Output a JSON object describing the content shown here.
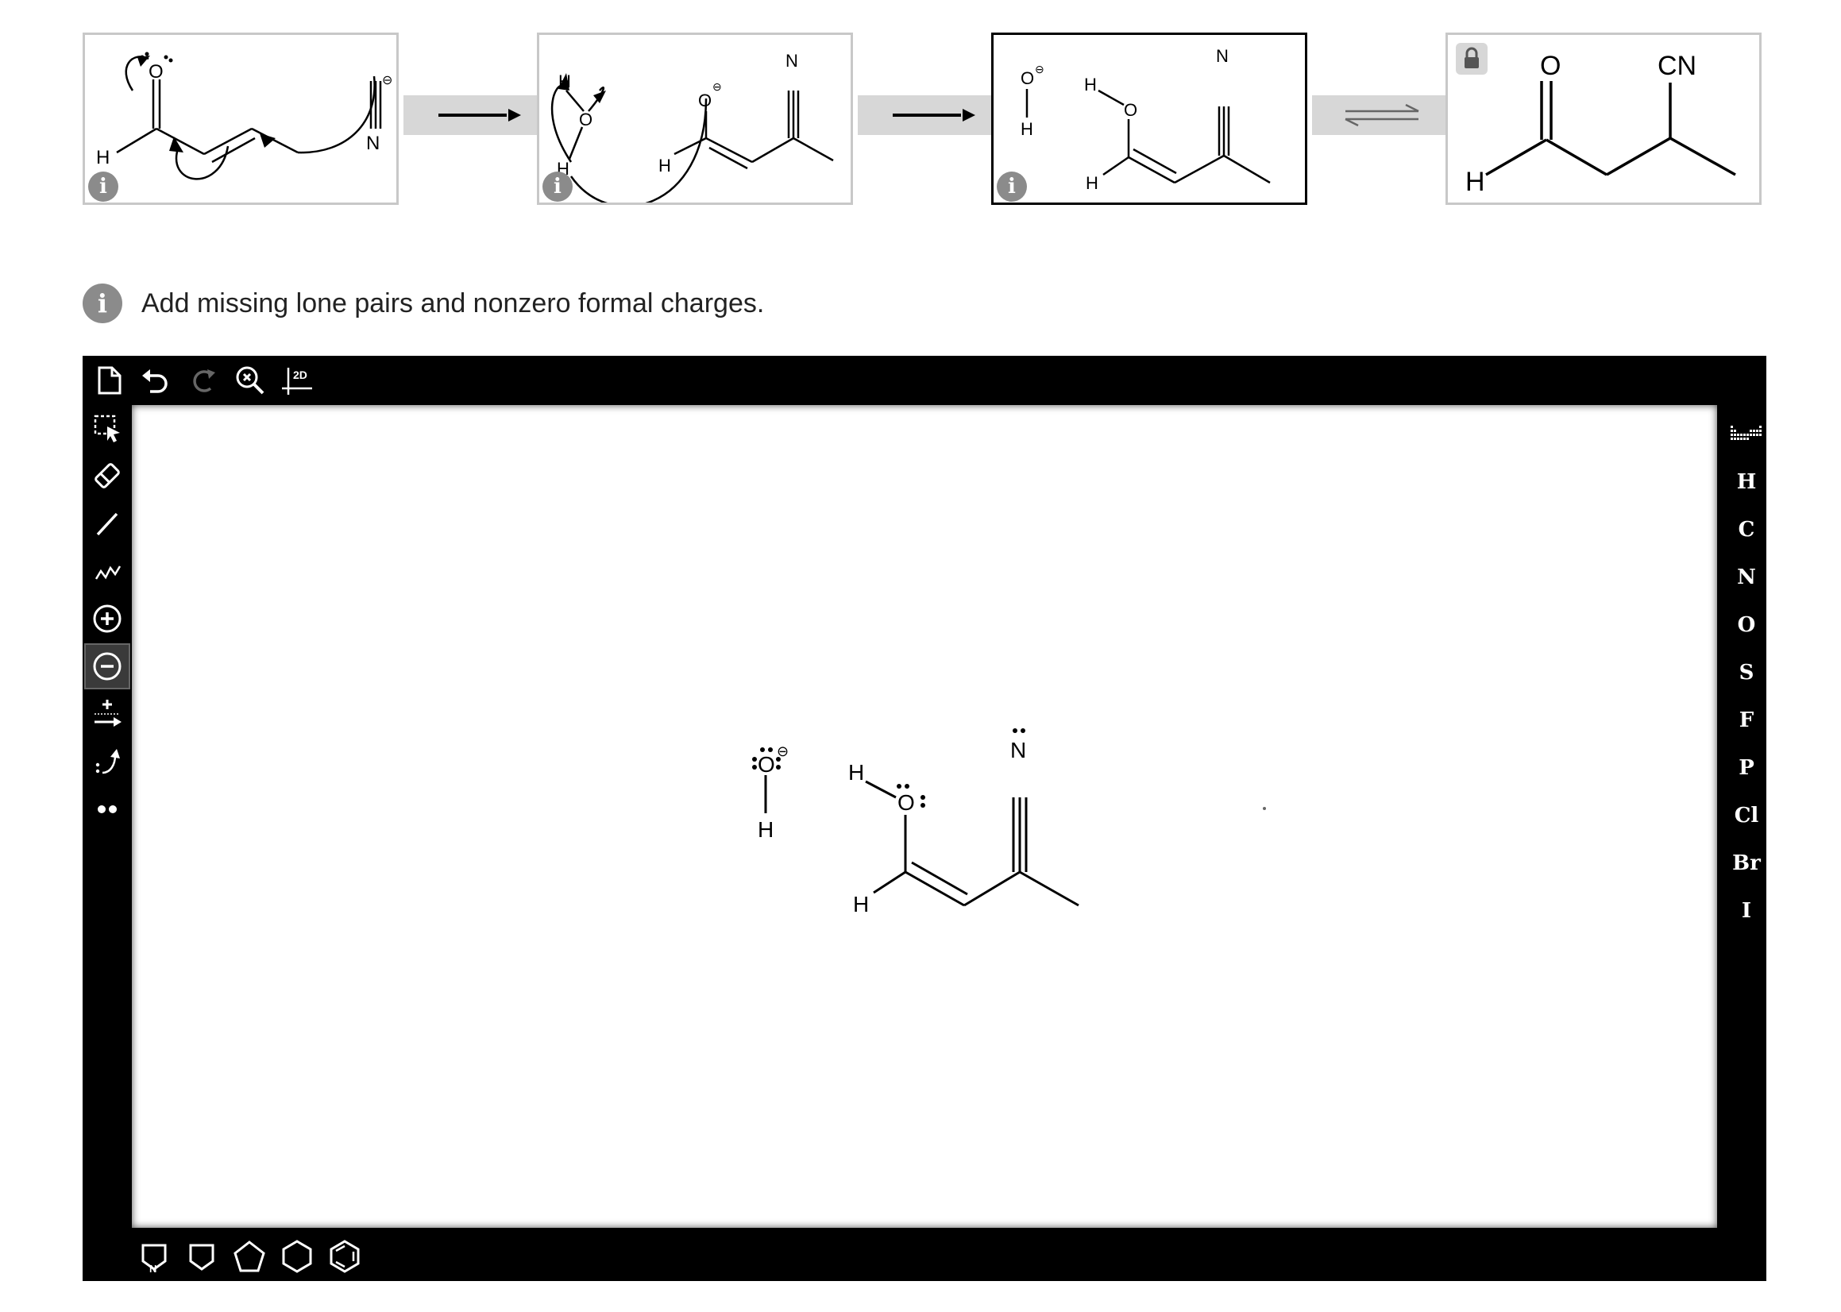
{
  "steps": [
    {
      "id": "step-1",
      "state": "completed",
      "has_info": true,
      "labels": {
        "o": "O",
        "n": "N",
        "h": "H",
        "charge": "⊖"
      }
    },
    {
      "id": "step-2",
      "state": "completed",
      "has_info": true,
      "labels": {
        "o_left": "O",
        "h_top": "H",
        "h_bottom": "H",
        "o_right": "O",
        "n": "N",
        "h_mid": "H",
        "charge": "⊖"
      }
    },
    {
      "id": "step-3",
      "state": "current",
      "has_info": true,
      "labels": {
        "o_hydroxide": "O",
        "h_hydroxide": "H",
        "h_oh": "H",
        "o": "O",
        "n": "N",
        "h_vinyl": "H",
        "charge": "⊖"
      }
    },
    {
      "id": "step-4",
      "state": "locked",
      "has_info": false,
      "labels": {
        "o": "O",
        "cn": "CN",
        "h": "H"
      }
    }
  ],
  "connectors": [
    {
      "arrow": "forward"
    },
    {
      "arrow": "forward"
    },
    {
      "arrow": "equilibrium"
    }
  ],
  "instruction": {
    "info_icon": "info-icon",
    "text": "Add missing lone pairs and nonzero formal charges."
  },
  "editor": {
    "top_tools": [
      {
        "name": "new-document",
        "icon": "document-icon"
      },
      {
        "name": "undo",
        "icon": "undo-icon"
      },
      {
        "name": "redo",
        "icon": "redo-icon",
        "disabled": true
      },
      {
        "name": "clean",
        "icon": "clean-zoom-icon"
      },
      {
        "name": "layout-2d",
        "icon": "2d-layout-icon",
        "label": "2D"
      }
    ],
    "left_tools": [
      {
        "name": "select",
        "icon": "lasso-select-icon"
      },
      {
        "name": "erase",
        "icon": "eraser-icon"
      },
      {
        "name": "bond",
        "icon": "single-bond-icon"
      },
      {
        "name": "chain",
        "icon": "chain-icon"
      },
      {
        "name": "plus-charge",
        "icon": "plus-charge-icon"
      },
      {
        "name": "minus-charge",
        "icon": "minus-charge-icon",
        "selected": true
      },
      {
        "name": "reaction-arrow",
        "icon": "reaction-arrow-icon"
      },
      {
        "name": "curved-arrow",
        "icon": "curved-arrow-icon"
      },
      {
        "name": "lone-pair",
        "icon": "lone-pair-icon"
      }
    ],
    "elements": [
      "H",
      "C",
      "N",
      "O",
      "S",
      "F",
      "P",
      "Cl",
      "Br",
      "I"
    ],
    "periodic_table_icon": "periodic-table-icon",
    "bottom_tools": [
      {
        "name": "pyrrole",
        "icon": "pyrrole-ring-icon",
        "label": "N"
      },
      {
        "name": "cyclobutane",
        "icon": "cyclobutane-icon"
      },
      {
        "name": "cyclopentane",
        "icon": "cyclopentane-icon"
      },
      {
        "name": "cyclohexane",
        "icon": "cyclohexane-icon"
      },
      {
        "name": "benzene",
        "icon": "benzene-icon"
      }
    ],
    "molecule_labels": {
      "o_hydroxide": "O",
      "h_hydroxide": "H",
      "h_oh": "H",
      "o": "O",
      "n": "N",
      "h_vinyl": "H",
      "charge": "⊖"
    }
  }
}
